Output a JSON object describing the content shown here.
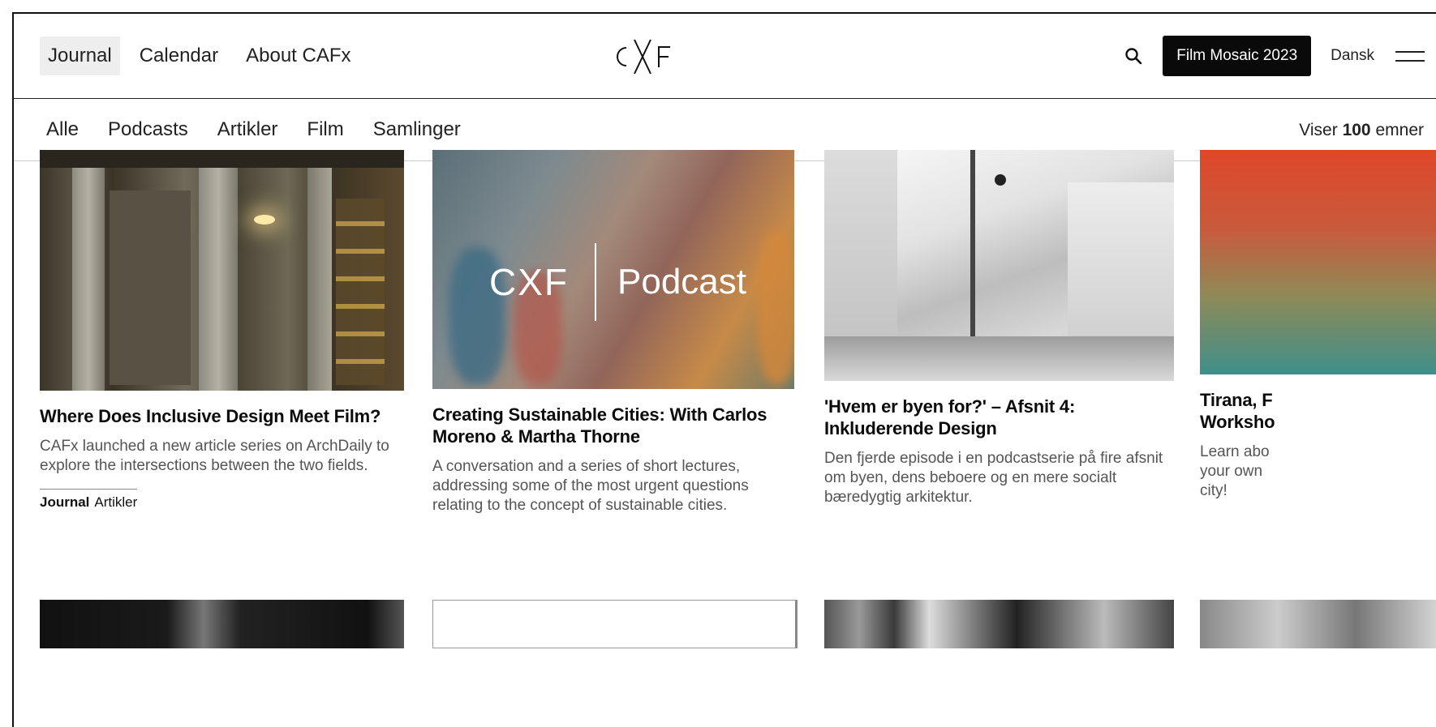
{
  "nav": {
    "items": [
      {
        "label": "Journal",
        "active": true
      },
      {
        "label": "Calendar",
        "active": false
      },
      {
        "label": "About CAFx",
        "active": false
      }
    ],
    "logo_text": "CXF",
    "cta_label": "Film Mosaic 2023",
    "language": "Dansk",
    "search_icon": "search-icon",
    "menu_icon": "hamburger-menu-icon"
  },
  "filters": {
    "items": [
      "Alle",
      "Podcasts",
      "Artikler",
      "Film",
      "Samlinger"
    ],
    "count_prefix": "Viser",
    "count_value": "100",
    "count_suffix": "emner"
  },
  "cards": [
    {
      "title": "Where Does Inclusive Design Meet Film?",
      "desc": "CAFx launched a new article series on ArchDaily to explore the intersections between the two fields.",
      "tag_primary": "Journal",
      "tag_secondary": "Artikler"
    },
    {
      "title": "Creating Sustainable Cities: With Carlos Moreno & Martha Thorne",
      "desc": "A conversation and a series of short lectures, addressing some of the most urgent questions relating to the concept of sustainable cities.",
      "image_logo": "CXF",
      "image_label": "Podcast"
    },
    {
      "title": "'Hvem er byen for?' – Afsnit 4: Inkluderende Design",
      "desc": "Den fjerde episode i en podcastserie på fire afsnit om byen, dens beboere og en mere socialt bæredygtig arkitektur."
    },
    {
      "title": "Tirana, F Worksho",
      "desc": "Learn abo your own city!"
    }
  ],
  "colors": {
    "cta_bg": "#0a0a0a",
    "active_nav_bg": "#eeeeee",
    "text": "#111111",
    "muted_text": "#555555"
  }
}
